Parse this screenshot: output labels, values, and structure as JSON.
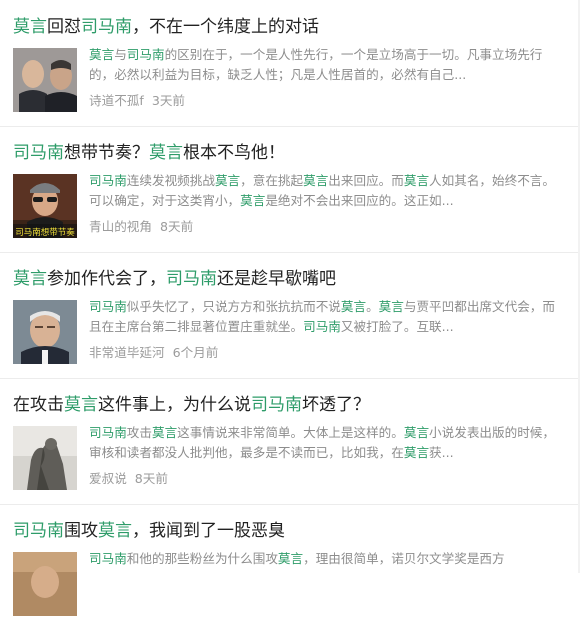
{
  "colors": {
    "highlight": "#2e9c69",
    "title": "#222222",
    "summary": "#8d8d8d",
    "meta": "#9b9b9b"
  },
  "items": [
    {
      "title": [
        {
          "t": "莫言",
          "hl": true
        },
        {
          "t": "回怼",
          "hl": false
        },
        {
          "t": "司马南",
          "hl": true
        },
        {
          "t": "，不在一个纬度上的对话",
          "hl": false
        }
      ],
      "thumbnail": "photo of two men",
      "summary": [
        {
          "t": "莫言",
          "hl": true
        },
        {
          "t": "与",
          "hl": false
        },
        {
          "t": "司马南",
          "hl": true
        },
        {
          "t": "的区别在于，一个是人性先行，一个是立场高于一切。凡事立场先行的，必然以利益为目标，缺乏人性；凡是人性居首的，必然有自己...",
          "hl": false
        }
      ],
      "author": "诗道不孤f",
      "time": "3天前"
    },
    {
      "title": [
        {
          "t": "司马南",
          "hl": true
        },
        {
          "t": "想带节奏？",
          "hl": false
        },
        {
          "t": "莫言",
          "hl": true
        },
        {
          "t": "根本不鸟他！",
          "hl": false
        }
      ],
      "thumbnail": "video frame with caption",
      "thumbnail_caption": "司马南想带节奏",
      "summary": [
        {
          "t": "司马南",
          "hl": true
        },
        {
          "t": "连续发视频挑战",
          "hl": false
        },
        {
          "t": "莫言",
          "hl": true
        },
        {
          "t": "，意在挑起",
          "hl": false
        },
        {
          "t": "莫言",
          "hl": true
        },
        {
          "t": "出来回应。而",
          "hl": false
        },
        {
          "t": "莫言",
          "hl": true
        },
        {
          "t": "人如其名，始终不言。可以确定，对于这类宵小，",
          "hl": false
        },
        {
          "t": "莫言",
          "hl": true
        },
        {
          "t": "是绝对不会出来回应的。这正如...",
          "hl": false
        }
      ],
      "author": "青山的视角",
      "time": "8天前"
    },
    {
      "title": [
        {
          "t": "莫言",
          "hl": true
        },
        {
          "t": "参加作代会了，",
          "hl": false
        },
        {
          "t": "司马南",
          "hl": true
        },
        {
          "t": "还是趁早歇嘴吧",
          "hl": false
        }
      ],
      "thumbnail": "portrait photo",
      "summary": [
        {
          "t": "司马南",
          "hl": true
        },
        {
          "t": "似乎失忆了，只说方方和张抗抗而不说",
          "hl": false
        },
        {
          "t": "莫言",
          "hl": true
        },
        {
          "t": "。",
          "hl": false
        },
        {
          "t": "莫言",
          "hl": true
        },
        {
          "t": "与贾平凹都出席文代会，而且在主席台第二排显著位置庄重就坐。",
          "hl": false
        },
        {
          "t": "司马南",
          "hl": true
        },
        {
          "t": "又被打脸了。互联...",
          "hl": false
        }
      ],
      "author": "非常道毕延河",
      "time": "6个月前"
    },
    {
      "title": [
        {
          "t": "在攻击",
          "hl": false
        },
        {
          "t": "莫言",
          "hl": true
        },
        {
          "t": "这件事上，为什么说",
          "hl": false
        },
        {
          "t": "司马南",
          "hl": true
        },
        {
          "t": "坏透了？",
          "hl": false
        }
      ],
      "thumbnail": "statue photo",
      "summary": [
        {
          "t": "司马南",
          "hl": true
        },
        {
          "t": "攻击",
          "hl": false
        },
        {
          "t": "莫言",
          "hl": true
        },
        {
          "t": "这事情说来非常简单。大体上是这样的。",
          "hl": false
        },
        {
          "t": "莫言",
          "hl": true
        },
        {
          "t": "小说发表出版的时候，审核和读者都没人批判他，最多是不读而已，比如我，在",
          "hl": false
        },
        {
          "t": "莫言",
          "hl": true
        },
        {
          "t": "获...",
          "hl": false
        }
      ],
      "author": "爱叔说",
      "time": "8天前"
    },
    {
      "title": [
        {
          "t": "司马南",
          "hl": true
        },
        {
          "t": "围攻",
          "hl": false
        },
        {
          "t": "莫言",
          "hl": true
        },
        {
          "t": "，我闻到了一股恶臭",
          "hl": false
        }
      ],
      "thumbnail": "photo",
      "summary": [
        {
          "t": "司马南",
          "hl": true
        },
        {
          "t": "和他的那些粉丝为什么围攻",
          "hl": false
        },
        {
          "t": "莫言",
          "hl": true
        },
        {
          "t": "，理由很简单，诺贝尔文学奖是西方",
          "hl": false
        }
      ],
      "author": "",
      "time": ""
    }
  ]
}
